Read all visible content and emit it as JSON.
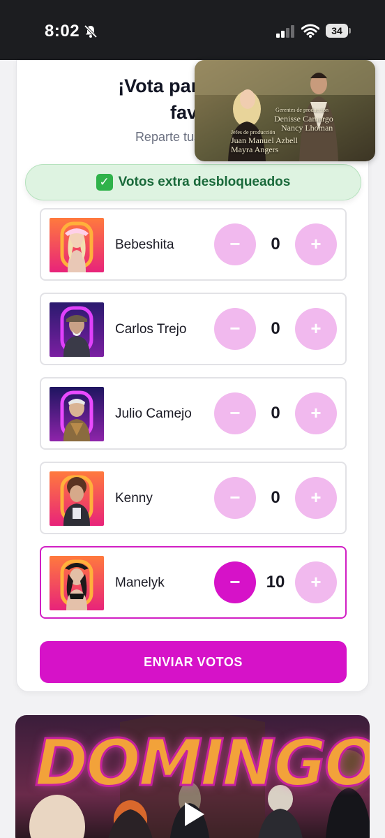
{
  "status_bar": {
    "time": "8:02",
    "battery": "34",
    "icons": [
      "bell-slash-icon",
      "signal-icon",
      "wifi-icon",
      "battery-icon"
    ]
  },
  "vote_card": {
    "title_line1": "¡Vota para salvar",
    "title_line2": "favor",
    "subtitle": "Reparte tus 10 votos",
    "extra_banner": "Votos extra desbloqueados",
    "candidates": [
      {
        "name": "Bebeshita",
        "votes": "0",
        "minus_label": "−",
        "plus_label": "+"
      },
      {
        "name": "Carlos Trejo",
        "votes": "0",
        "minus_label": "−",
        "plus_label": "+"
      },
      {
        "name": "Julio Camejo",
        "votes": "0",
        "minus_label": "−",
        "plus_label": "+"
      },
      {
        "name": "Kenny",
        "votes": "0",
        "minus_label": "−",
        "plus_label": "+"
      },
      {
        "name": "Manelyk",
        "votes": "10",
        "minus_label": "−",
        "plus_label": "+"
      }
    ],
    "submit_label": "ENVIAR VOTOS"
  },
  "video_overlay": {
    "credit_heading_1": "Gerentes de producción",
    "credit_name_1": "Denisse Camargo",
    "credit_name_2": "Nancy Lhoman",
    "credit_heading_2": "Jefes de producción",
    "credit_name_3": "Juan Manuel Azbell",
    "credit_name_4": "Mayra Angers"
  },
  "promo_banner": {
    "title": "DOMINGO"
  },
  "colors": {
    "accent": "#d612c8",
    "accent_light": "#f1b9ee",
    "success_bg": "#def3e1",
    "success_text": "#19693a"
  }
}
